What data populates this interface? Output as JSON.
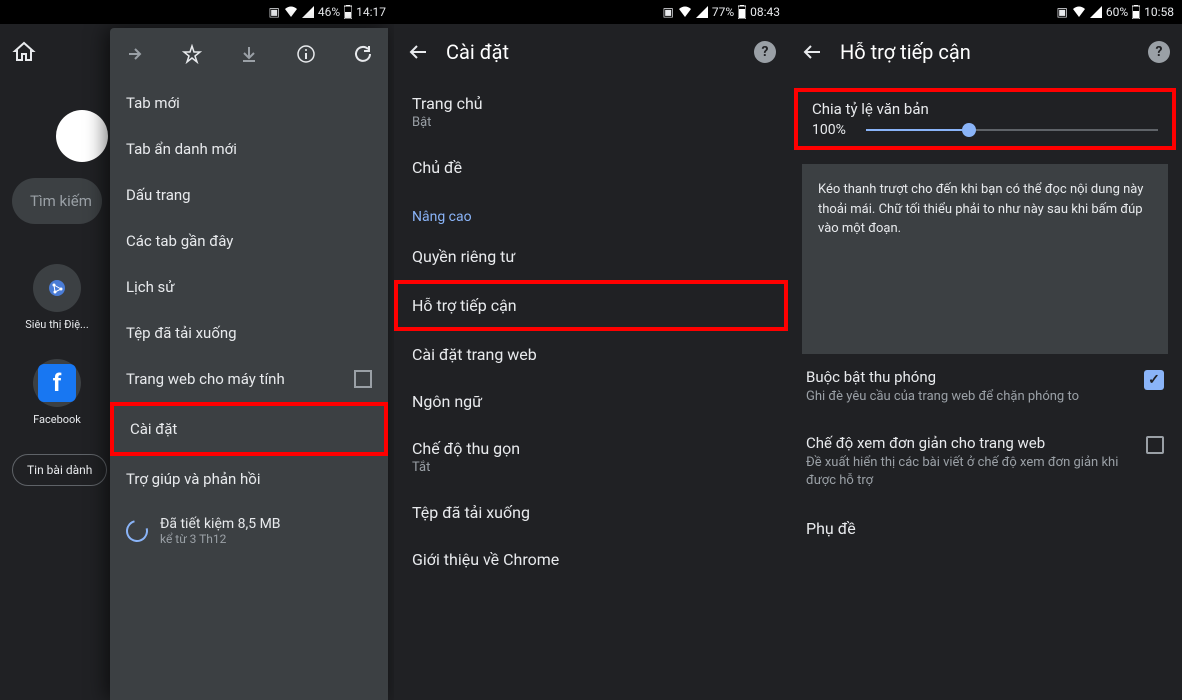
{
  "phone1": {
    "status": {
      "battery": "46%",
      "time": "14:17"
    },
    "search_placeholder": "Tìm kiếm",
    "shortcuts": {
      "s1": "Siêu thị Điệ...",
      "s2": "Facebook"
    },
    "chip": "Tin bài dành",
    "menu": {
      "items": {
        "new_tab": "Tab mới",
        "incognito": "Tab ẩn danh mới",
        "bookmarks": "Dấu trang",
        "recent": "Các tab gần đây",
        "history": "Lịch sử",
        "downloads": "Tệp đã tải xuống",
        "desktop": "Trang web cho máy tính",
        "settings": "Cài đặt",
        "help": "Trợ giúp và phản hồi"
      },
      "saved": {
        "line1": "Đã tiết kiệm 8,5 MB",
        "line2": "kể từ 3 Th12"
      }
    }
  },
  "phone2": {
    "status": {
      "battery": "77%",
      "time": "08:43"
    },
    "title": "Cài đặt",
    "items": {
      "homepage": {
        "p": "Trang chủ",
        "s": "Bật"
      },
      "theme": "Chủ đề",
      "advanced": "Nâng cao",
      "privacy": "Quyền riêng tư",
      "accessibility": "Hỗ trợ tiếp cận",
      "site": "Cài đặt trang web",
      "language": "Ngôn ngữ",
      "lite": {
        "p": "Chế độ thu gọn",
        "s": "Tắt"
      },
      "downloads": "Tệp đã tải xuống",
      "about": "Giới thiệu về Chrome"
    }
  },
  "phone3": {
    "status": {
      "battery": "60%",
      "time": "10:58"
    },
    "title": "Hỗ trợ tiếp cận",
    "scale": {
      "label": "Chia tỷ lệ văn bản",
      "value": "100%"
    },
    "desc": "Kéo thanh trượt cho đến khi bạn có thể đọc nội dung này thoải mái. Chữ tối thiểu phải to như này sau khi bấm đúp vào một đoạn.",
    "zoom": {
      "p": "Buộc bật thu phóng",
      "s": "Ghi đè yêu cầu của trang web để chặn phóng to"
    },
    "simple": {
      "p": "Chế độ xem đơn giản cho trang web",
      "s": "Đề xuất hiển thị các bài viết ở chế độ xem đơn giản khi được hỗ trợ"
    },
    "captions": "Phụ đề"
  }
}
